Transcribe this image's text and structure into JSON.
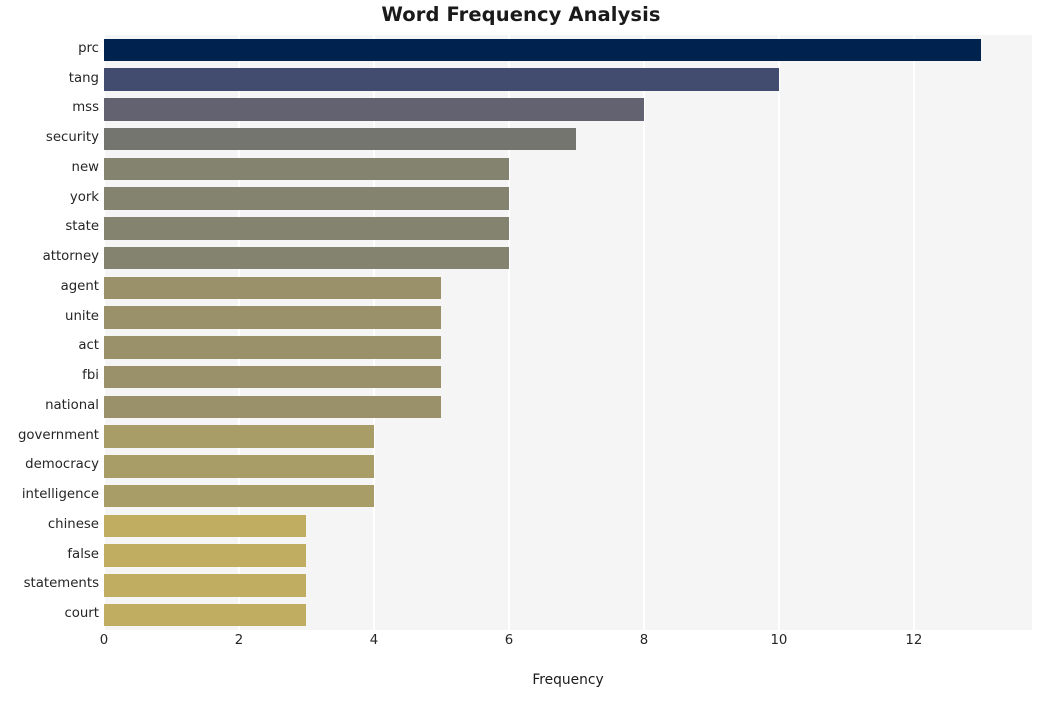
{
  "chart_data": {
    "type": "bar",
    "orientation": "horizontal",
    "title": "Word Frequency Analysis",
    "xlabel": "Frequency",
    "ylabel": "",
    "categories": [
      "prc",
      "tang",
      "mss",
      "security",
      "new",
      "york",
      "state",
      "attorney",
      "agent",
      "unite",
      "act",
      "fbi",
      "national",
      "government",
      "democracy",
      "intelligence",
      "chinese",
      "false",
      "statements",
      "court"
    ],
    "values": [
      13,
      10,
      8,
      7,
      6,
      6,
      6,
      6,
      5,
      5,
      5,
      5,
      5,
      4,
      4,
      4,
      3,
      3,
      3,
      3
    ],
    "bar_colors": [
      "#00224e",
      "#414c6f",
      "#626270",
      "#75756f",
      "#84836f",
      "#84836f",
      "#84836f",
      "#84836f",
      "#9a9069",
      "#9a9069",
      "#9a9069",
      "#9a9069",
      "#9a9069",
      "#a99d67",
      "#a99d67",
      "#a99d67",
      "#c0ad62",
      "#c0ad62",
      "#c0ad62",
      "#c0ad62"
    ],
    "xticks": [
      0,
      2,
      4,
      6,
      8,
      10,
      12
    ],
    "xlim": [
      0,
      13.75
    ],
    "grid": true,
    "grid_color": "#ffffff",
    "plot_background": "#f5f5f5",
    "figure_background": "#ffffff",
    "legend": null,
    "colormap": "cividis"
  }
}
